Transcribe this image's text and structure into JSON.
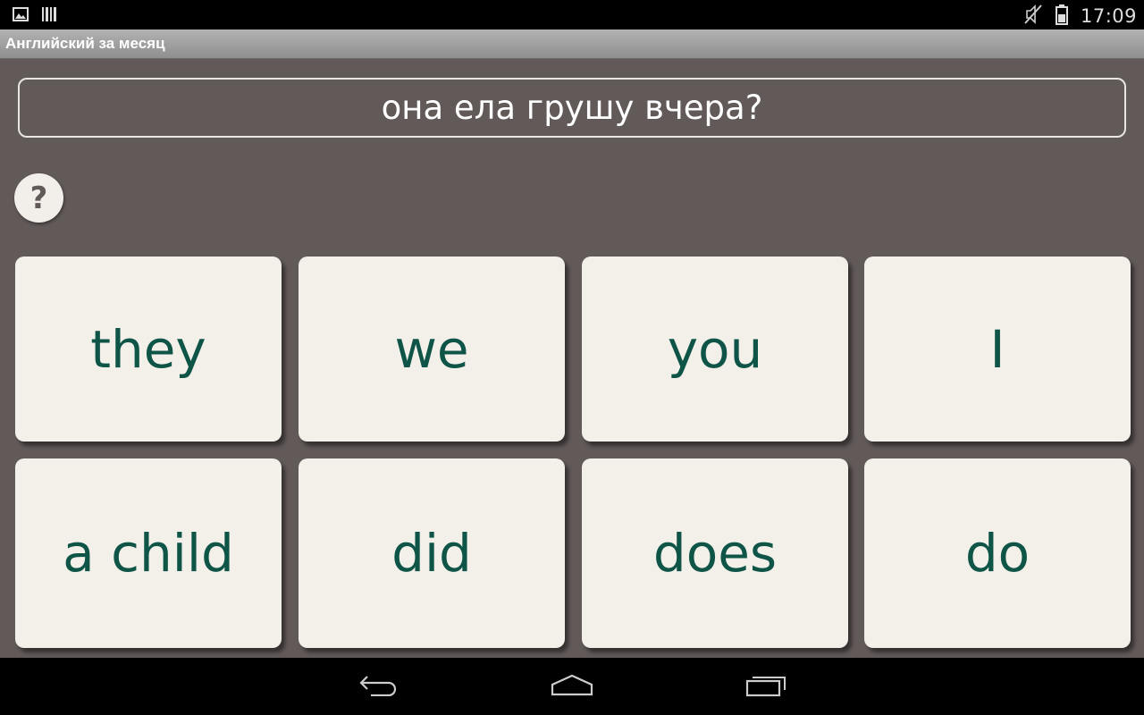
{
  "status_bar": {
    "time": "17:09",
    "left_icons": [
      "image-icon",
      "barcode-icon"
    ],
    "right_icons": [
      "mute-icon",
      "battery-icon"
    ]
  },
  "app": {
    "title": "Английский за месяц"
  },
  "question": {
    "text": "она ела грушу вчера?"
  },
  "help": {
    "glyph": "?"
  },
  "cards": [
    {
      "label": "they"
    },
    {
      "label": "we"
    },
    {
      "label": "you"
    },
    {
      "label": "I"
    },
    {
      "label": "a child"
    },
    {
      "label": "did"
    },
    {
      "label": "does"
    },
    {
      "label": "do"
    }
  ],
  "nav_bar": {
    "icons": [
      "back-icon",
      "home-icon",
      "recent-apps-icon"
    ]
  },
  "colors": {
    "background": "#625959",
    "card": "#f3f0ea",
    "card_text": "#0e5447"
  }
}
